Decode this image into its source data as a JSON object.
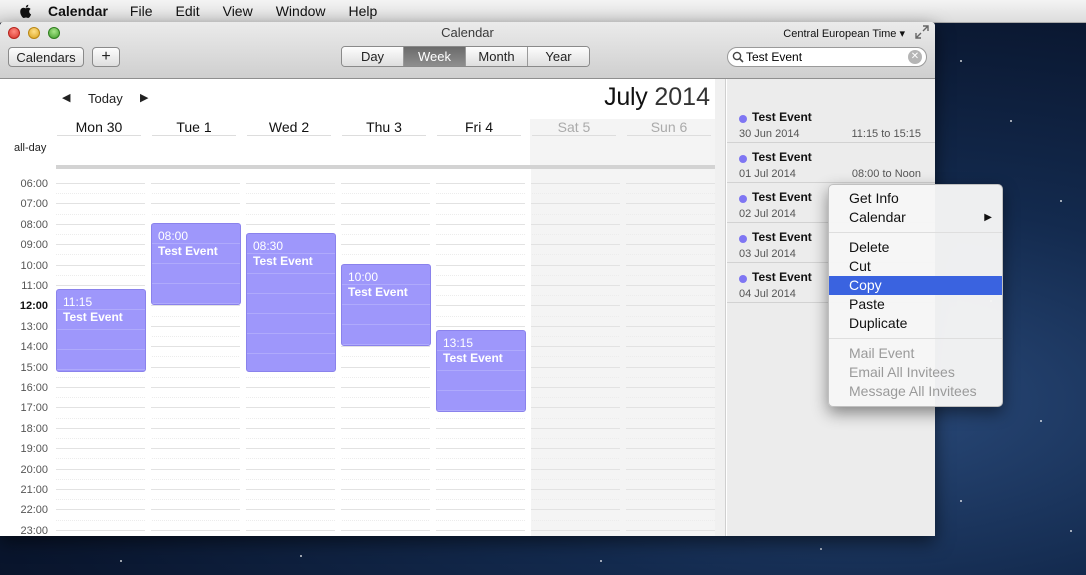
{
  "menubar": {
    "app": "Calendar",
    "items": [
      "File",
      "Edit",
      "View",
      "Window",
      "Help"
    ]
  },
  "window": {
    "title": "Calendar",
    "timezone": "Central European Time ▾"
  },
  "toolbar": {
    "calendars_label": "Calendars",
    "add_label": "+",
    "views": [
      "Day",
      "Week",
      "Month",
      "Year"
    ],
    "active_view": "Week",
    "search_value": "Test Event"
  },
  "calendar": {
    "nav": {
      "prev": "◀",
      "today": "Today",
      "next": "▶"
    },
    "month": "July",
    "year": "2014",
    "days": [
      "Mon 30",
      "Tue 1",
      "Wed 2",
      "Thu 3",
      "Fri 4",
      "Sat 5",
      "Sun 6"
    ],
    "allday_label": "all-day",
    "hours": [
      "06:00",
      "07:00",
      "08:00",
      "09:00",
      "10:00",
      "11:00",
      "12:00",
      "13:00",
      "14:00",
      "15:00",
      "16:00",
      "17:00",
      "18:00",
      "19:00",
      "20:00",
      "21:00",
      "22:00",
      "23:00"
    ],
    "current_hour": "12:00",
    "event_color": "#9e97fb",
    "events": [
      {
        "day": 0,
        "start": 11.25,
        "end": 15.25,
        "time": "11:15",
        "title": "Test Event"
      },
      {
        "day": 1,
        "start": 8.0,
        "end": 12.0,
        "time": "08:00",
        "title": "Test Event"
      },
      {
        "day": 2,
        "start": 8.5,
        "end": 15.25,
        "time": "08:30",
        "title": "Test Event"
      },
      {
        "day": 3,
        "start": 10.0,
        "end": 14.0,
        "time": "10:00",
        "title": "Test Event"
      },
      {
        "day": 4,
        "start": 13.25,
        "end": 17.25,
        "time": "13:15",
        "title": "Test Event"
      }
    ]
  },
  "results": [
    {
      "title": "Test Event",
      "date": "30 Jun 2014",
      "time": "11:15 to 15:15"
    },
    {
      "title": "Test Event",
      "date": "01 Jul 2014",
      "time": "08:00 to Noon"
    },
    {
      "title": "Test Event",
      "date": "02 Jul 2014",
      "time": ""
    },
    {
      "title": "Test Event",
      "date": "03 Jul 2014",
      "time": ""
    },
    {
      "title": "Test Event",
      "date": "04 Jul 2014",
      "time": ""
    }
  ],
  "context_menu": {
    "groups": [
      [
        {
          "label": "Get Info",
          "enabled": true
        },
        {
          "label": "Calendar",
          "enabled": true,
          "submenu": true
        }
      ],
      [
        {
          "label": "Delete",
          "enabled": true
        },
        {
          "label": "Cut",
          "enabled": true
        },
        {
          "label": "Copy",
          "enabled": true,
          "selected": true
        },
        {
          "label": "Paste",
          "enabled": true
        },
        {
          "label": "Duplicate",
          "enabled": true
        }
      ],
      [
        {
          "label": "Mail Event",
          "enabled": false
        },
        {
          "label": "Email All Invitees",
          "enabled": false
        },
        {
          "label": "Message All Invitees",
          "enabled": false
        }
      ]
    ]
  }
}
